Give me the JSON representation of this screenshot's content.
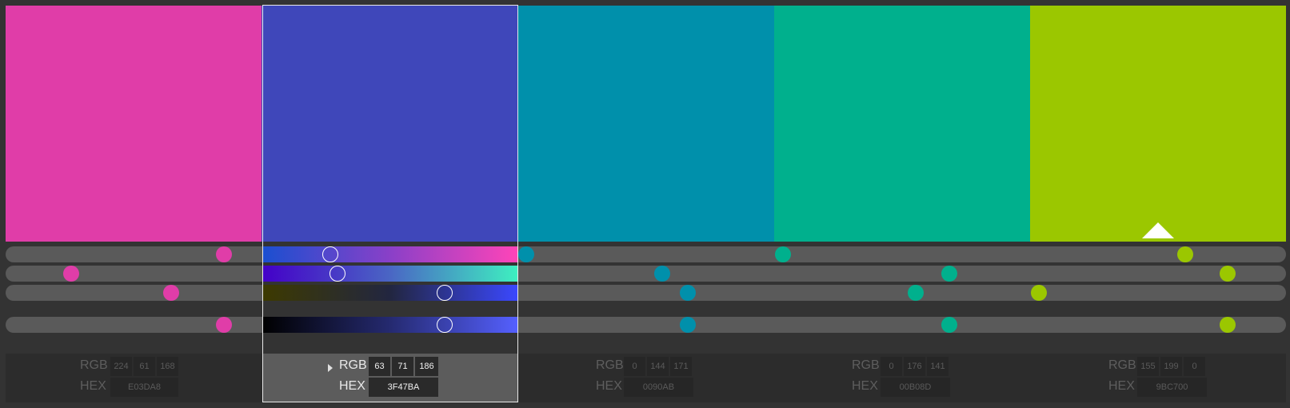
{
  "swatches": [
    {
      "color": "#E03DA8",
      "rgb": [
        "224",
        "61",
        "168"
      ],
      "hex": "E03DA8"
    },
    {
      "color": "#3F47BA",
      "rgb": [
        "63",
        "71",
        "186"
      ],
      "hex": "3F47BA"
    },
    {
      "color": "#0090AB",
      "rgb": [
        "0",
        "144",
        "171"
      ],
      "hex": "0090AB"
    },
    {
      "color": "#00B08D",
      "rgb": [
        "0",
        "176",
        "141"
      ],
      "hex": "00B08D"
    },
    {
      "color": "#9BC700",
      "rgb": [
        "155",
        "199",
        "0"
      ],
      "hex": "9BC700"
    }
  ],
  "selected_index": 1,
  "labels": {
    "rgb": "RGB",
    "hex": "HEX"
  },
  "icons": {
    "expand": "caret-right-icon",
    "base_marker": "triangle-up-icon"
  },
  "base_swatch_index": 4
}
